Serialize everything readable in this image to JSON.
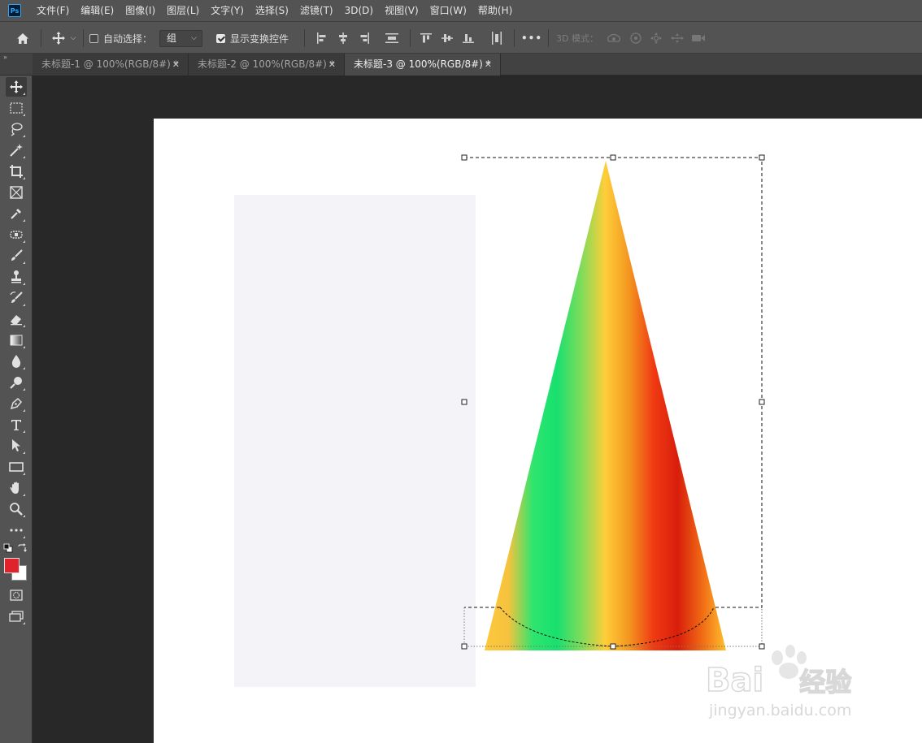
{
  "app": {
    "logo_text": "Ps"
  },
  "menu": [
    {
      "label": "文件(F)"
    },
    {
      "label": "编辑(E)"
    },
    {
      "label": "图像(I)"
    },
    {
      "label": "图层(L)"
    },
    {
      "label": "文字(Y)"
    },
    {
      "label": "选择(S)"
    },
    {
      "label": "滤镜(T)"
    },
    {
      "label": "3D(D)"
    },
    {
      "label": "视图(V)"
    },
    {
      "label": "窗口(W)"
    },
    {
      "label": "帮助(H)"
    }
  ],
  "options": {
    "auto_select_label": "自动选择：",
    "auto_select_checked": false,
    "auto_select_value": "组",
    "show_transform_label": "显示变换控件",
    "show_transform_checked": true,
    "more_label": "•••",
    "mode_3d_label": "3D 模式："
  },
  "tabs": [
    {
      "label": "未标题-1 @ 100%(RGB/8#) *",
      "active": false
    },
    {
      "label": "未标题-2 @ 100%(RGB/8#) *",
      "active": false
    },
    {
      "label": "未标题-3 @ 100%(RGB/8#) *",
      "active": true
    }
  ],
  "tools": [
    "move-tool",
    "marquee-tool",
    "lasso-tool",
    "magic-wand-tool",
    "crop-tool",
    "frame-tool",
    "eyedropper-tool",
    "healing-brush-tool",
    "brush-tool",
    "clone-stamp-tool",
    "history-brush-tool",
    "eraser-tool",
    "gradient-tool",
    "blur-tool",
    "dodge-tool",
    "pen-tool",
    "type-tool",
    "path-selection-tool",
    "rectangle-tool",
    "hand-tool",
    "zoom-tool",
    "more-tools"
  ],
  "colors": {
    "foreground": "#e0232b",
    "background": "#ffffff",
    "cone_gradient": [
      "#ffc83c",
      "#f5c23e",
      "#2ee56e",
      "#18e06f",
      "#7edc5a",
      "#ffce3a",
      "#f3951f",
      "#f03a12",
      "#d81e0c",
      "#f06a14",
      "#ffc02e"
    ]
  },
  "watermark": {
    "brand": "Bai",
    "brand_suffix": "经验",
    "url": "jingyan.baidu.com"
  }
}
